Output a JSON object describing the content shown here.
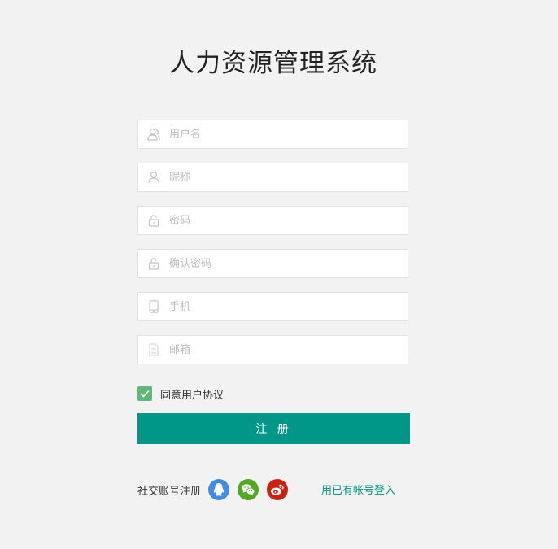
{
  "title": "人力资源管理系统",
  "form": {
    "fields": [
      {
        "placeholder": "用户名",
        "value": "",
        "icon": "user-icon"
      },
      {
        "placeholder": "昵称",
        "value": "",
        "icon": "person-icon"
      },
      {
        "placeholder": "密码",
        "value": "",
        "icon": "lock-icon"
      },
      {
        "placeholder": "确认密码",
        "value": "",
        "icon": "lock-icon"
      },
      {
        "placeholder": "手机",
        "value": "",
        "icon": "phone-icon"
      },
      {
        "placeholder": "邮箱",
        "value": "",
        "icon": "document-icon"
      }
    ],
    "agree_label": "同意用户协议",
    "agree_checked": true,
    "submit_label": "注 册"
  },
  "social": {
    "label": "社交账号注册",
    "accounts": [
      {
        "name": "qq",
        "icon": "qq-icon",
        "color": "#3d8ce6"
      },
      {
        "name": "wechat",
        "icon": "wechat-icon",
        "color": "#52a81f"
      },
      {
        "name": "weibo",
        "icon": "weibo-icon",
        "color": "#cf1f10"
      }
    ],
    "login_link": "用已有帐号登入"
  },
  "colors": {
    "background": "#f2f2f2",
    "primary": "#009688",
    "checkbox": "#5fb878",
    "placeholder": "#bdbdbd"
  }
}
